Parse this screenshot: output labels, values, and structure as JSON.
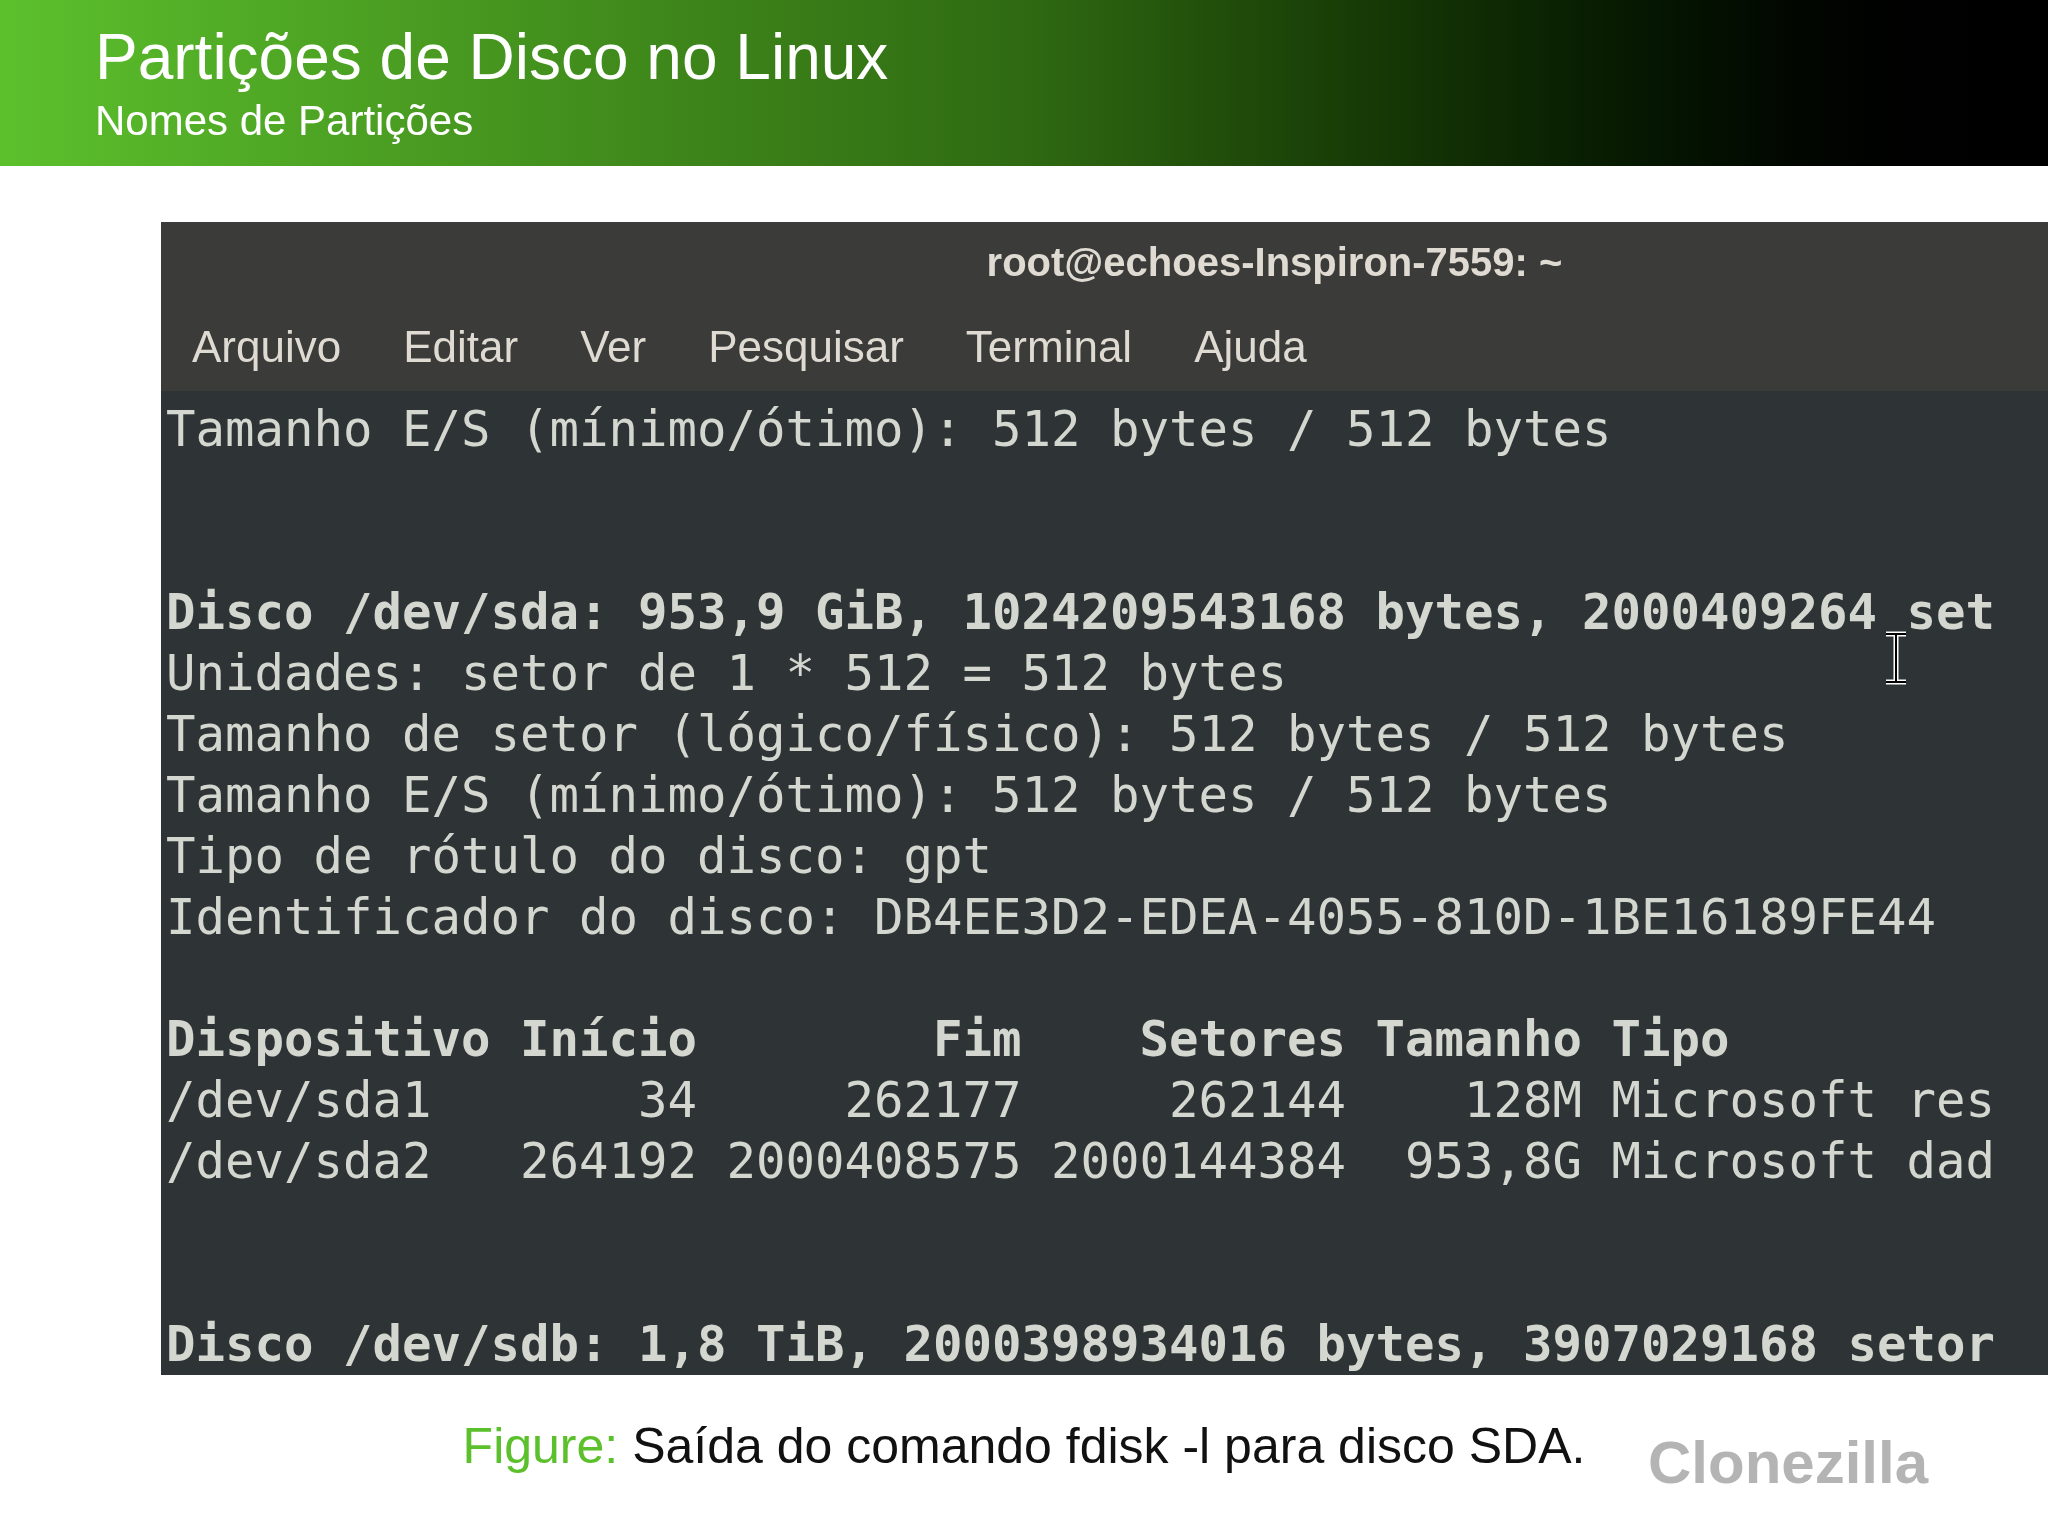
{
  "header": {
    "title": "Partições de Disco no Linux",
    "subtitle": "Nomes de Partições"
  },
  "terminal": {
    "title": "root@echoes-Inspiron-7559: ~",
    "menu": [
      "Arquivo",
      "Editar",
      "Ver",
      "Pesquisar",
      "Terminal",
      "Ajuda"
    ],
    "lines": [
      {
        "kind": "text",
        "bold": false,
        "text": "Tamanho E/S (mínimo/ótimo): 512 bytes / 512 bytes"
      },
      {
        "kind": "blank"
      },
      {
        "kind": "blank"
      },
      {
        "kind": "text",
        "bold": true,
        "text": "Disco /dev/sda: 953,9 GiB, 1024209543168 bytes, 2000409264 set"
      },
      {
        "kind": "text",
        "bold": false,
        "text": "Unidades: setor de 1 * 512 = 512 bytes"
      },
      {
        "kind": "text",
        "bold": false,
        "text": "Tamanho de setor (lógico/físico): 512 bytes / 512 bytes"
      },
      {
        "kind": "text",
        "bold": false,
        "text": "Tamanho E/S (mínimo/ótimo): 512 bytes / 512 bytes"
      },
      {
        "kind": "text",
        "bold": false,
        "text": "Tipo de rótulo do disco: gpt"
      },
      {
        "kind": "text",
        "bold": false,
        "text": "Identificador do disco: DB4EE3D2-EDEA-4055-810D-1BE16189FE44"
      },
      {
        "kind": "blank"
      },
      {
        "kind": "row",
        "bold": true,
        "cells": [
          "Dispositivo",
          "Início",
          "Fim",
          "Setores",
          "Tamanho",
          "Tipo"
        ]
      },
      {
        "kind": "row",
        "bold": false,
        "cells": [
          "/dev/sda1",
          "34",
          "262177",
          "262144",
          "128M",
          "Microsoft res"
        ]
      },
      {
        "kind": "row",
        "bold": false,
        "cells": [
          "/dev/sda2",
          "264192",
          "2000408575",
          "2000144384",
          "953,8G",
          "Microsoft dad"
        ]
      },
      {
        "kind": "blank"
      },
      {
        "kind": "blank"
      },
      {
        "kind": "text",
        "bold": true,
        "text": "Disco /dev/sdb: 1,8 TiB, 2000398934016 bytes, 3907029168 setor"
      }
    ]
  },
  "caption": {
    "label": "Figure:",
    "text": "Saída do comando fdisk -l para disco SDA."
  },
  "logo": {
    "text": "Clonezilla"
  }
}
